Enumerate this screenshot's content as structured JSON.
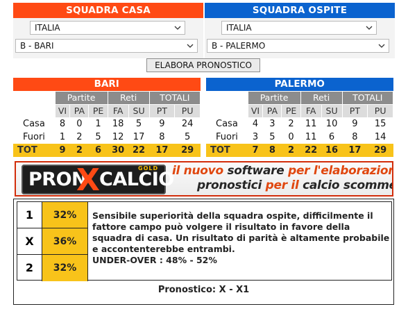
{
  "home_panel": {
    "title": "SQUADRA CASA",
    "country": "ITALIA",
    "team": "B - BARI"
  },
  "away_panel": {
    "title": "SQUADRA OSPITE",
    "country": "ITALIA",
    "team": "B - PALERMO"
  },
  "elabora_button": "ELABORA PRONOSTICO",
  "stats_labels": {
    "partite": "Partite",
    "reti": "Reti",
    "totali": "TOTALI",
    "cols": [
      "VI",
      "PA",
      "PE",
      "FA",
      "SU",
      "PT",
      "PU"
    ],
    "casa": "Casa",
    "fuori": "Fuori",
    "tot": "TOT"
  },
  "home_stats": {
    "name": "BARI",
    "casa": [
      "8",
      "0",
      "1",
      "18",
      "5",
      "9",
      "24"
    ],
    "fuori": [
      "1",
      "2",
      "5",
      "12",
      "17",
      "8",
      "5"
    ],
    "tot": [
      "9",
      "2",
      "6",
      "30",
      "22",
      "17",
      "29"
    ]
  },
  "away_stats": {
    "name": "PALERMO",
    "casa": [
      "4",
      "3",
      "2",
      "11",
      "10",
      "9",
      "15"
    ],
    "fuori": [
      "3",
      "5",
      "0",
      "11",
      "6",
      "8",
      "14"
    ],
    "tot": [
      "7",
      "8",
      "2",
      "22",
      "16",
      "17",
      "29"
    ]
  },
  "banner": {
    "logo_pron": "PRON",
    "logo_x": "X",
    "logo_calcio": "CALCIO",
    "logo_gold": "GOLD",
    "line1_a": "il nuovo ",
    "line1_b": "software",
    "line1_c": " per l'elaborazione dei",
    "line2_a": "pronostici",
    "line2_b": " per il ",
    "line2_c": "calcio scommesse"
  },
  "odds": [
    {
      "sign": "1",
      "pct": "32%"
    },
    {
      "sign": "X",
      "pct": "36%"
    },
    {
      "sign": "2",
      "pct": "32%"
    }
  ],
  "description": "Sensibile superiorità della squadra ospite, difficilmente il fattore campo può volgere il risultato in favore della squadra di casa. Un risultato di parità è altamente probabile e accontenterebbe entrambi.",
  "under_over": "UNDER-OVER : 48% - 52%",
  "pronostico": "Pronostico: X - X1",
  "colors": {
    "home": "#ff4a14",
    "away": "#0b63cf",
    "highlight": "#f8c31a",
    "group_header": "#8c8c8c"
  }
}
